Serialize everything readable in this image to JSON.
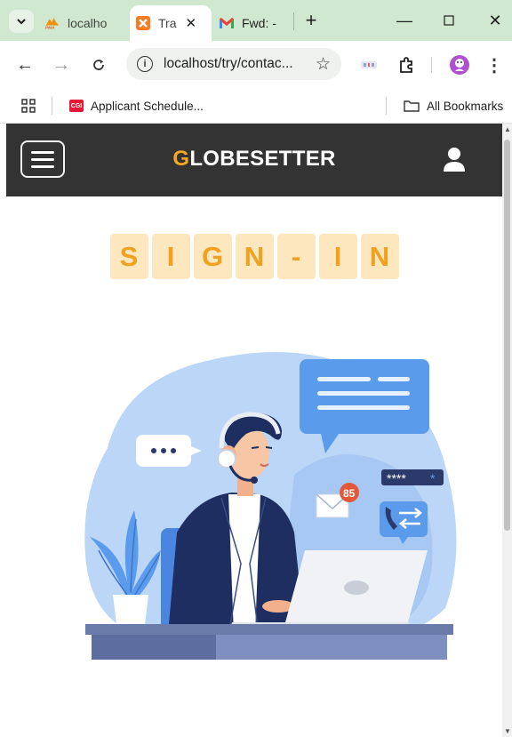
{
  "browser": {
    "tabs": [
      {
        "label": "localho",
        "favicon": "phpmyadmin-icon",
        "active": false
      },
      {
        "label": "Tra",
        "favicon": "xampp-icon",
        "active": true
      },
      {
        "label": "Fwd: -",
        "favicon": "gmail-icon",
        "active": false
      }
    ],
    "url": "localhost/try/contac...",
    "bookmarks": [
      {
        "label": "Applicant Schedule...",
        "favicon": "cgi-icon",
        "favicon_text": "CGI"
      },
      {
        "label": "All Bookmarks",
        "favicon": "folder-icon"
      }
    ],
    "phpmyadmin_badge": "PMA"
  },
  "site": {
    "brand_first": "G",
    "brand_rest": "LOBESETTER",
    "signin_letters": [
      "S",
      "I",
      "G",
      "N",
      "-",
      "I",
      "N"
    ]
  },
  "illustration": {
    "email_badge": "85",
    "password_mask": "****",
    "password_cursor": "*"
  },
  "colors": {
    "navbar": "#333333",
    "brand_accent": "#f5a623",
    "tile_bg": "#fde7bf",
    "tile_text": "#f0a120",
    "tabstrip": "#cfe8cf",
    "illustration_blue": "#bcd6f7"
  }
}
